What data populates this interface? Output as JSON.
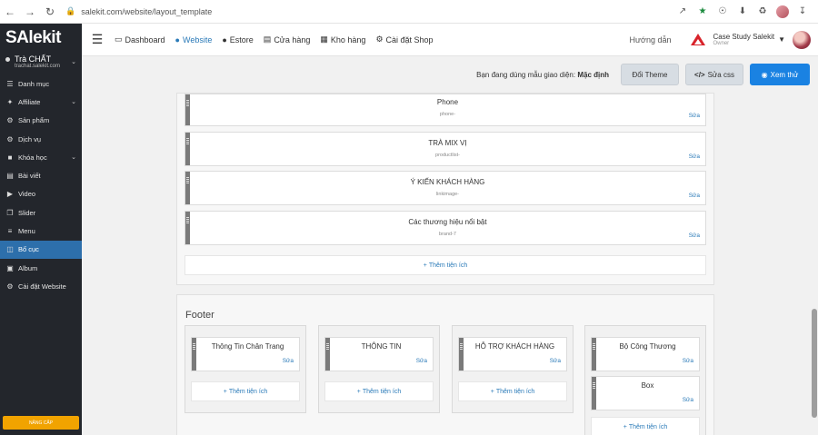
{
  "browser": {
    "url": "salekit.com/website/layout_template"
  },
  "sidebar": {
    "logo": "SAlekit",
    "shop_name": "Trà CHẤT",
    "shop_domain": "trachat.salekit.com",
    "items": [
      {
        "label": "Danh mục",
        "icon": "list-icon"
      },
      {
        "label": "Affiliate",
        "icon": "affiliate-icon",
        "expand": true
      },
      {
        "label": "Sản phẩm",
        "icon": "product-icon"
      },
      {
        "label": "Dịch vụ",
        "icon": "service-icon"
      },
      {
        "label": "Khóa học",
        "icon": "course-icon",
        "expand": true
      },
      {
        "label": "Bài viết",
        "icon": "article-icon"
      },
      {
        "label": "Video",
        "icon": "video-icon"
      },
      {
        "label": "Slider",
        "icon": "slider-icon"
      },
      {
        "label": "Menu",
        "icon": "menu-icon"
      },
      {
        "label": "Bố cục",
        "icon": "layout-icon",
        "active": true
      },
      {
        "label": "Album",
        "icon": "album-icon"
      },
      {
        "label": "Cài đặt Website",
        "icon": "settings-icon"
      }
    ],
    "upgrade_label": "NÂNG CẤP"
  },
  "topbar": {
    "nav": [
      {
        "label": "Dashboard",
        "icon": "monitor-icon"
      },
      {
        "label": "Website",
        "icon": "globe-icon",
        "active": true
      },
      {
        "label": "Estore",
        "icon": "globe-icon"
      },
      {
        "label": "Cửa hàng",
        "icon": "store-icon"
      },
      {
        "label": "Kho hàng",
        "icon": "box-icon"
      },
      {
        "label": "Cài đặt Shop",
        "icon": "gear-icon"
      }
    ],
    "guide": "Hướng dẫn",
    "account_name": "Case Study Salekit",
    "account_role": "Owner"
  },
  "actions": {
    "theme_prefix": "Bạn đang dùng mẫu giao diện:",
    "theme_name": "Mặc định",
    "change_theme": "Đổi Theme",
    "edit_css": "Sửa css",
    "preview": "Xem thử"
  },
  "body_widgets": [
    {
      "title": "Phone",
      "code": "phone-",
      "edit": "Sửa"
    },
    {
      "title": "TRÀ MIX VỊ",
      "code": "productlist-",
      "edit": "Sửa"
    },
    {
      "title": "Ý KIẾN KHÁCH HÀNG",
      "code": "linkimage-",
      "edit": "Sửa"
    },
    {
      "title": "Các thương hiệu nổi bật",
      "code": "brand-7",
      "edit": "Sửa"
    }
  ],
  "add_widget_label": "Thêm tiện ích",
  "footer": {
    "title": "Footer",
    "columns": [
      {
        "widgets": [
          {
            "title": "Thông Tin Chân Trang",
            "edit": "Sửa"
          }
        ],
        "add": "Thêm tiện ích"
      },
      {
        "widgets": [
          {
            "title": "THÔNG TIN",
            "edit": "Sửa"
          }
        ],
        "add": "Thêm tiện ích"
      },
      {
        "widgets": [
          {
            "title": "HỖ TRỢ KHÁCH HÀNG",
            "edit": "Sửa"
          }
        ],
        "add": "Thêm tiện ích"
      },
      {
        "widgets": [
          {
            "title": "Bộ Công Thương",
            "edit": "Sửa"
          },
          {
            "title": "Box",
            "edit": "Sửa"
          }
        ],
        "add": "Thêm tiện ích"
      }
    ]
  }
}
